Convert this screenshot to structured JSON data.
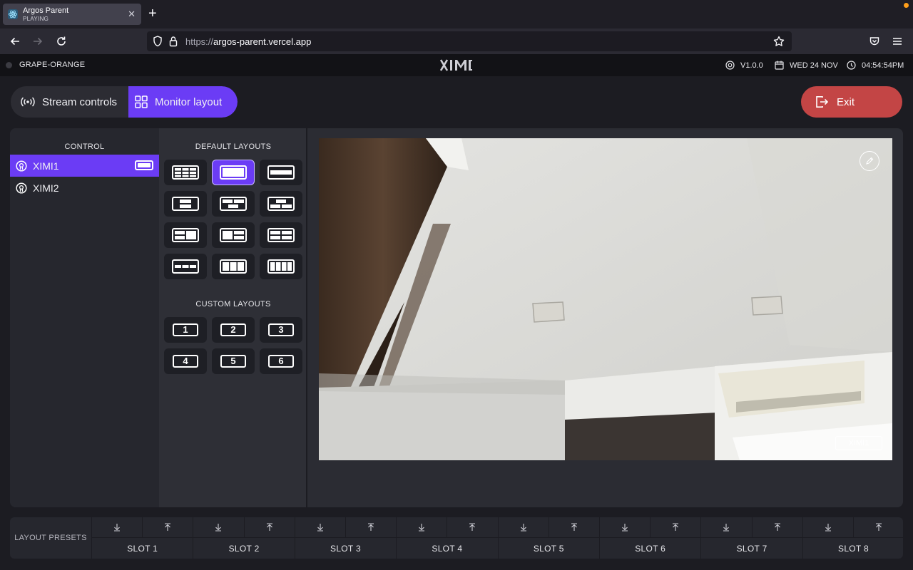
{
  "browser": {
    "tab_title": "Argos Parent",
    "tab_status": "PLAYING",
    "url_protocol": "https://",
    "url_host": "argos-parent.vercel.app"
  },
  "header": {
    "device_name": "GRAPE-ORANGE",
    "logo_icon": "ximi-logo-icon",
    "version": "V1.0.0",
    "date": "WED 24 NOV",
    "time": "04:54:54PM"
  },
  "toolbar": {
    "stream_controls_label": "Stream controls",
    "monitor_layout_label": "Monitor layout",
    "exit_label": "Exit",
    "accent": "#6b3cf5",
    "exit_color": "#c34545"
  },
  "control": {
    "heading": "CONTROL",
    "devices": [
      {
        "label": "XIMI1",
        "selected": true
      },
      {
        "label": "XIMI2",
        "selected": false
      }
    ]
  },
  "layouts": {
    "default_heading": "DEFAULT LAYOUTS",
    "custom_heading": "CUSTOM LAYOUTS",
    "custom": [
      "1",
      "2",
      "3",
      "4",
      "5",
      "6"
    ],
    "selected_default_index": 1
  },
  "preview": {
    "slot_label": "XIMI1",
    "edit_icon": "pencil-icon"
  },
  "presets": {
    "label": "LAYOUT PRESETS",
    "slots": [
      "SLOT 1",
      "SLOT 2",
      "SLOT 3",
      "SLOT 4",
      "SLOT 5",
      "SLOT 6",
      "SLOT 7",
      "SLOT 8"
    ]
  }
}
